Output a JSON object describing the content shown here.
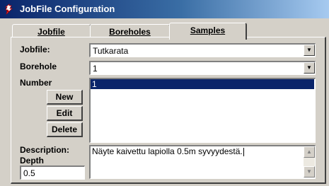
{
  "window": {
    "title": "JobFile Configuration"
  },
  "tabs": [
    {
      "label": "Jobfile",
      "accel": "J",
      "selected": false
    },
    {
      "label": "Boreholes",
      "accel": "B",
      "selected": false
    },
    {
      "label": "Samples",
      "accel": "S",
      "selected": true
    }
  ],
  "form": {
    "jobfile_label": "Jobfile:",
    "jobfile_value": "Tutkarata",
    "borehole_label": "Borehole",
    "borehole_value": "1",
    "number_label": "Number",
    "number_items": [
      "1"
    ],
    "buttons": {
      "new": "New",
      "edit": "Edit",
      "delete": "Delete"
    },
    "description_label": "Description:",
    "description_value": "Näyte kaivettu lapiolla 0.5m syvyydestä.",
    "depth_label": "Depth",
    "depth_value": "0.5"
  },
  "icons": {
    "app": "app-icon",
    "dropdown": "chevron-down-icon",
    "scroll_up": "scroll-up-icon",
    "scroll_down": "scroll-down-icon"
  },
  "colors": {
    "titlebar_start": "#0a246a",
    "titlebar_end": "#a6caf0",
    "selection": "#0a246a",
    "face": "#d4d0c8"
  }
}
